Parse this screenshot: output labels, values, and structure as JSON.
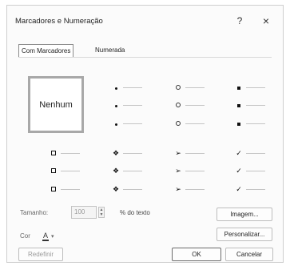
{
  "dialog": {
    "title": "Marcadores e Numeração",
    "help": "?",
    "close": "×"
  },
  "tabs": [
    {
      "label": "Com Marcadores",
      "selected": true
    },
    {
      "label": "Numerada",
      "selected": false
    }
  ],
  "gallery": {
    "none_label": "Nenhum",
    "selected": "none",
    "styles": [
      {
        "icon": "filled-round-bullet-icon"
      },
      {
        "icon": "hollow-round-bullet-icon"
      },
      {
        "icon": "filled-square-bullet-icon"
      },
      {
        "icon": "hollow-square-bullet-icon"
      },
      {
        "icon": "four-diamond-bullet-icon"
      },
      {
        "icon": "arrowhead-bullet-icon"
      },
      {
        "icon": "checkmark-bullet-icon"
      }
    ]
  },
  "size": {
    "label": "Tamanho:",
    "value": "100",
    "unit": "% do texto",
    "up": "▲",
    "down": "▼"
  },
  "color": {
    "label": "Cor",
    "swatch_glyph": "A",
    "chevron": "▾"
  },
  "buttons": {
    "image": "Imagem...",
    "customize": "Personalizar...",
    "reset": "Redefinir",
    "ok": "OK",
    "cancel": "Cancelar"
  }
}
